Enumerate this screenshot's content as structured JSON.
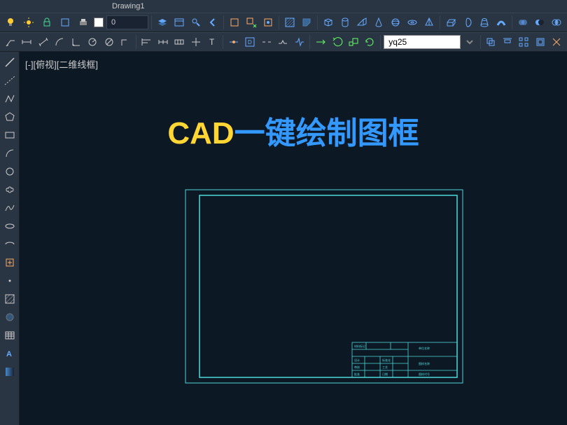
{
  "topbar": {
    "tab_label": "Drawing1"
  },
  "toolbar1": {
    "layer_value": "0"
  },
  "toolbar2": {
    "dropdown_value": "yq25"
  },
  "view": {
    "label": "[-][俯视][二维线框]"
  },
  "headline": {
    "part1": "CAD",
    "part2": "一键绘制图框"
  },
  "title_block": {
    "r1c1": "设计",
    "r1c2": "标准化",
    "r2c1": "审核",
    "r2c2": "工艺",
    "r3c1": "批准",
    "r3c2": "日期",
    "header1": "材料标记",
    "header2": "单位名称",
    "header3": "图样名称",
    "header4": "图样代号"
  }
}
